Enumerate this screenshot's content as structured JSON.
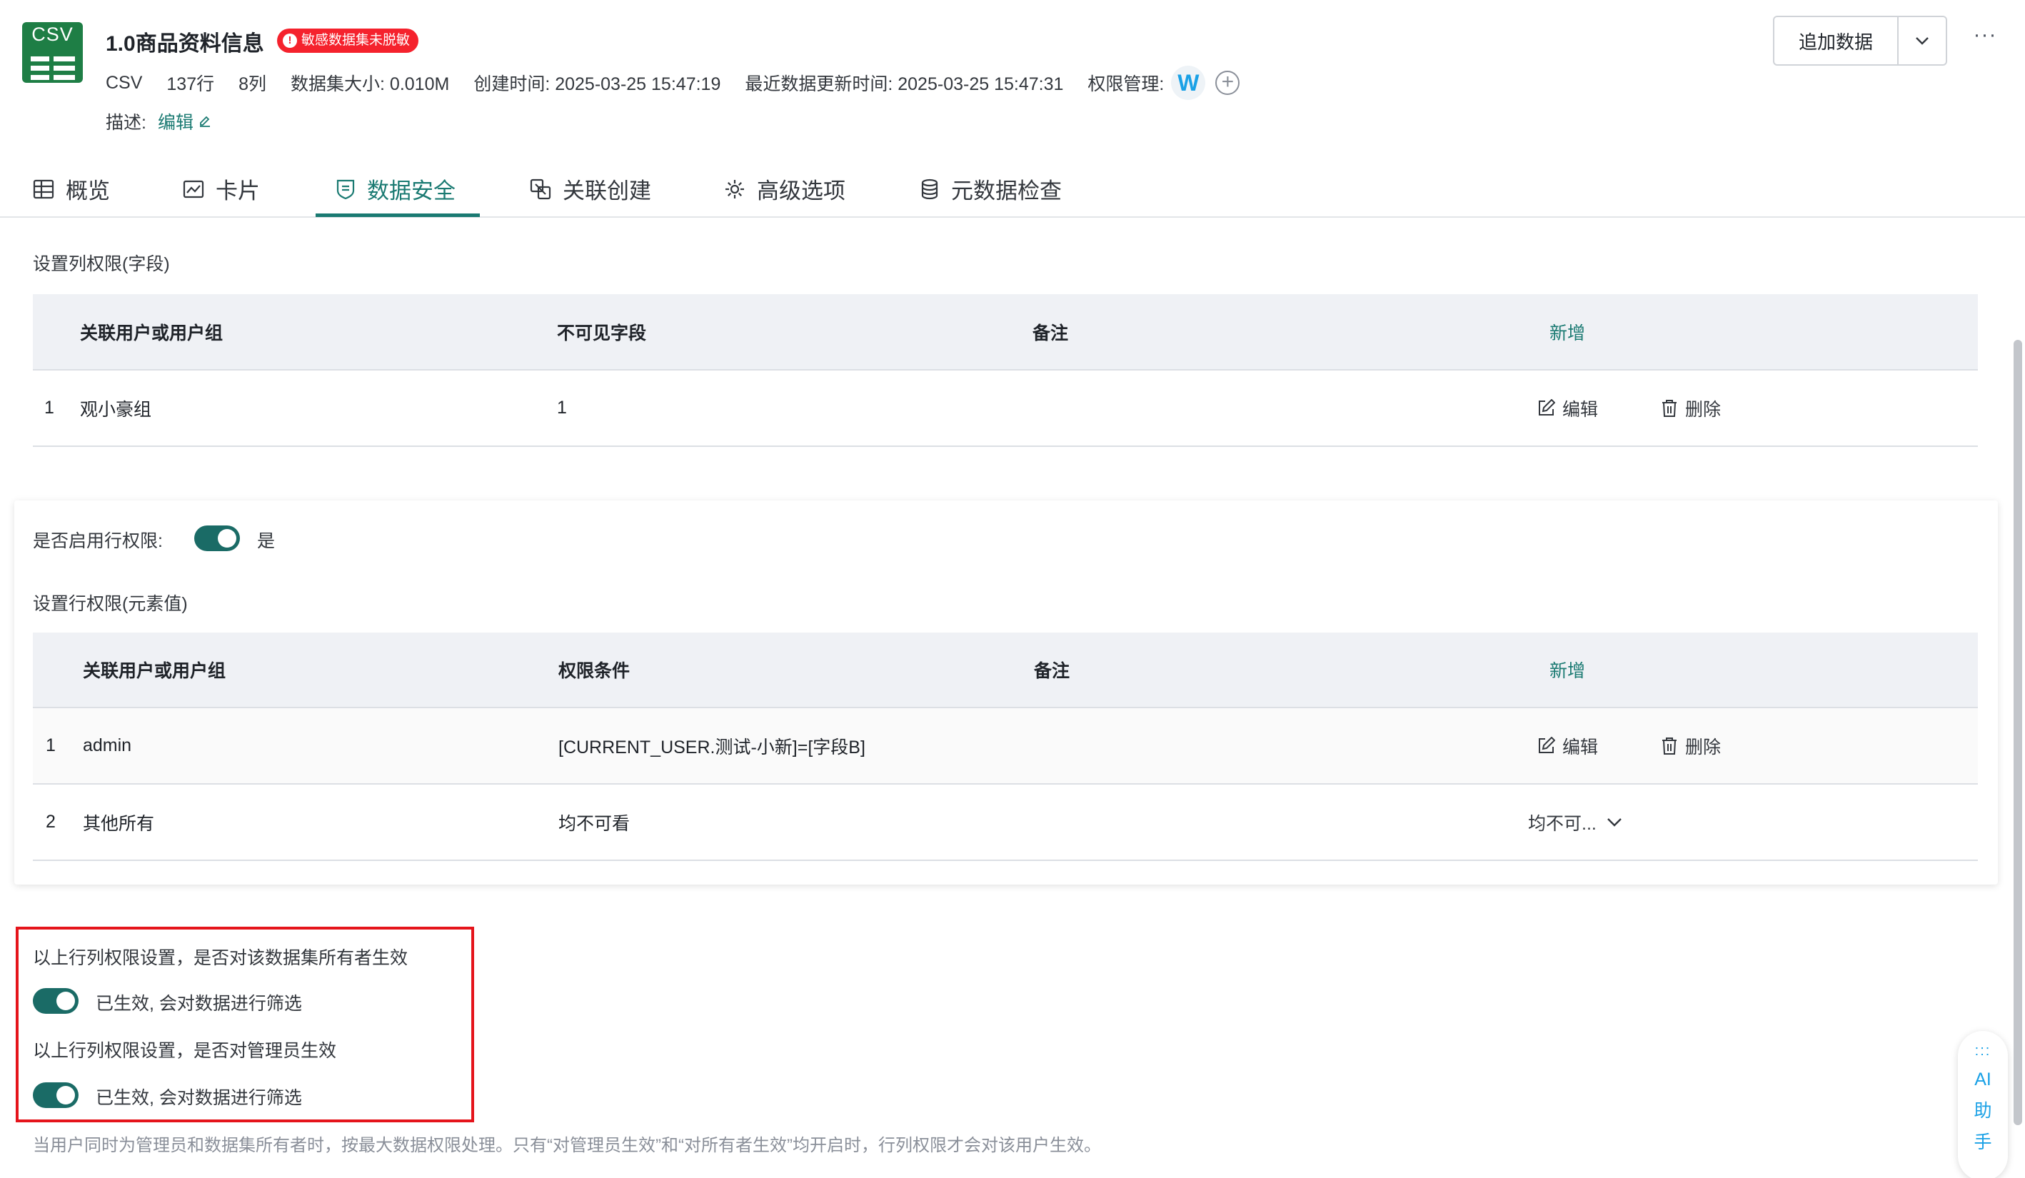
{
  "dataset": {
    "logo_text": "CSV",
    "title": "1.0商品资料信息",
    "badge": "敏感数据集未脱敏",
    "meta": {
      "format": "CSV",
      "rows": "137行",
      "cols": "8列",
      "size": "数据集大小: 0.010M",
      "created": "创建时间: 2025-03-25 15:47:19",
      "updated": "最近数据更新时间: 2025-03-25 15:47:31",
      "perm_label": "权限管理:",
      "perm_avatar": "W"
    },
    "description_label": "描述:",
    "description_edit": "编辑"
  },
  "header_actions": {
    "append_button": "追加数据",
    "more": "···"
  },
  "tabs": [
    {
      "label": "概览",
      "icon": "table-icon"
    },
    {
      "label": "卡片",
      "icon": "chart-card-icon"
    },
    {
      "label": "数据安全",
      "icon": "shield-icon",
      "active": true
    },
    {
      "label": "关联创建",
      "icon": "link-create-icon"
    },
    {
      "label": "高级选项",
      "icon": "gear-icon"
    },
    {
      "label": "元数据检查",
      "icon": "database-icon"
    }
  ],
  "column_permission": {
    "title": "设置列权限(字段)",
    "headers": {
      "user": "关联用户或用户组",
      "field": "不可见字段",
      "note": "备注",
      "add": "新增"
    },
    "rows": [
      {
        "idx": "1",
        "user": "观小豪组",
        "field": "1",
        "note": "",
        "edit": "编辑",
        "delete": "删除"
      }
    ]
  },
  "row_permission": {
    "enable_label": "是否启用行权限:",
    "enable_value": "是",
    "title": "设置行权限(元素值)",
    "headers": {
      "user": "关联用户或用户组",
      "condition": "权限条件",
      "note": "备注",
      "add": "新增"
    },
    "rows": [
      {
        "idx": "1",
        "user": "admin",
        "condition": "[CURRENT_USER.测试-小新]=[字段B]",
        "note": "",
        "edit": "编辑",
        "delete": "删除"
      },
      {
        "idx": "2",
        "user": "其他所有",
        "condition": "均不可看",
        "note": "",
        "select": "均不可..."
      }
    ]
  },
  "effect_settings": {
    "owner_question": "以上行列权限设置，是否对该数据集所有者生效",
    "owner_status": "已生效, 会对数据进行筛选",
    "admin_question": "以上行列权限设置，是否对管理员生效",
    "admin_status": "已生效, 会对数据进行筛选",
    "footnote": "当用户同时为管理员和数据集所有者时，按最大数据权限处理。只有“对管理员生效”和“对所有者生效”均开启时，行列权限才会对该用户生效。"
  },
  "ai_assistant": {
    "dots": ":::",
    "line1": "AI",
    "line2": "助",
    "line3": "手"
  },
  "colors": {
    "accent": "#1a7a72",
    "toggle_on": "#1a6b66",
    "badge_red": "#f5222d",
    "highlight_red": "#e5141b"
  }
}
